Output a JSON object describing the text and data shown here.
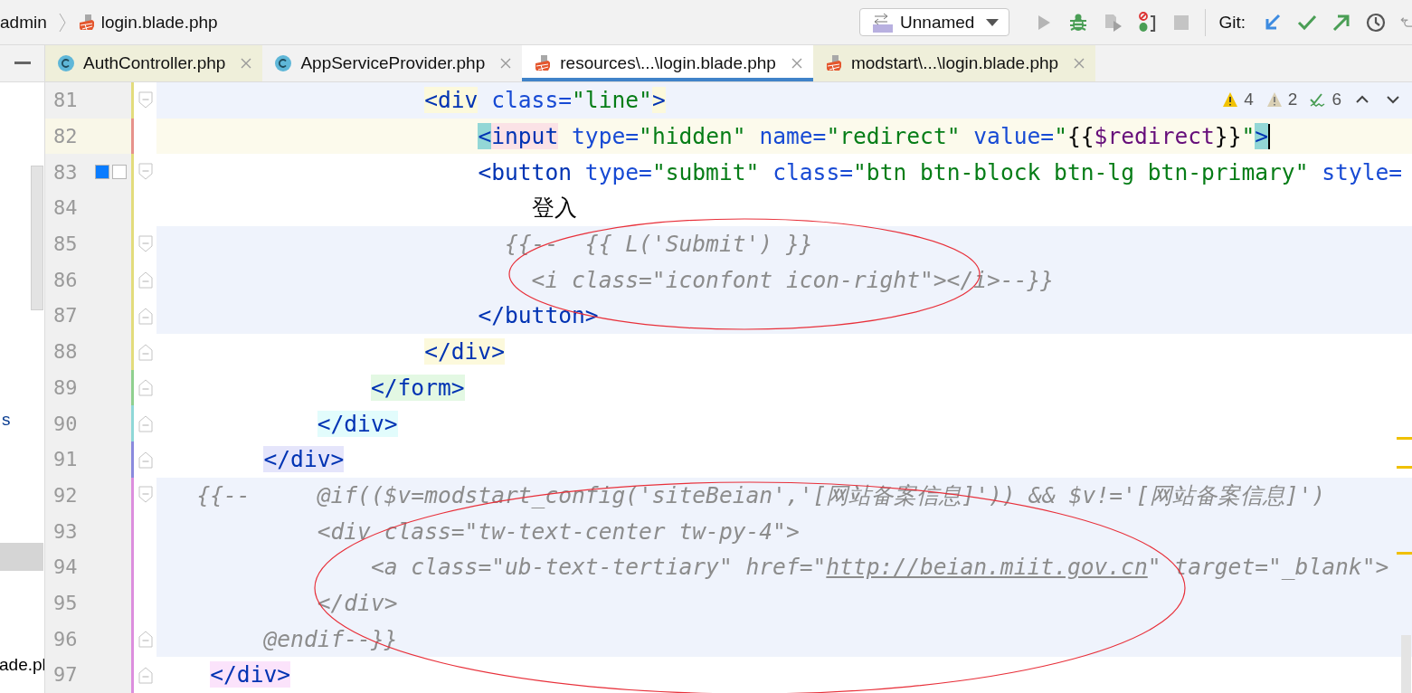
{
  "breadcrumb": {
    "items": [
      {
        "label": "admin",
        "kind": "folder"
      },
      {
        "label": "login.blade.php",
        "kind": "blade"
      }
    ]
  },
  "run_config": {
    "label": "Unnamed"
  },
  "git": {
    "label": "Git:"
  },
  "sidebar": {
    "fragments": [
      "s",
      "ade.pl"
    ]
  },
  "tabs": [
    {
      "label": "AuthController.php",
      "kind": "class",
      "selected": false,
      "color": "#efefda"
    },
    {
      "label": "AppServiceProvider.php",
      "kind": "class",
      "selected": false,
      "color": "#f2f2f2"
    },
    {
      "label": "resources\\...\\login.blade.php",
      "kind": "blade",
      "selected": true,
      "color": "#ffffff"
    },
    {
      "label": "modstart\\...\\login.blade.php",
      "kind": "blade",
      "selected": false,
      "color": "#efefda"
    }
  ],
  "inspections": {
    "warnings": "4",
    "weak_warnings": "2",
    "typos": "6"
  },
  "editor": {
    "lines": [
      {
        "number": "81",
        "color": "#e3dc7c",
        "kind": "fold_start",
        "shaded": true,
        "current": false,
        "tokens": [
          {
            "kind": "tag",
            "text": "                    <div",
            "color": "#fcf9dc"
          },
          {
            "kind": "attr",
            "text": " class="
          },
          {
            "kind": "string",
            "text": "\"line\""
          },
          {
            "kind": "tag",
            "text": ">",
            "color": "#fcf9dc"
          }
        ]
      },
      {
        "number": "82",
        "color": "#e7928b",
        "kind": "plain",
        "current": true,
        "shaded": false,
        "tokens": [
          {
            "kind": "tag",
            "text": "                        <",
            "color": "#93d7d6"
          },
          {
            "kind": "tag",
            "text": "input",
            "color": "#fbe2e6"
          },
          {
            "kind": "attr",
            "text": " type="
          },
          {
            "kind": "string",
            "text": "\"hidden\""
          },
          {
            "kind": "attr",
            "text": " name="
          },
          {
            "kind": "string",
            "text": "\"redirect\""
          },
          {
            "kind": "attr",
            "text": " value="
          },
          {
            "kind": "string",
            "text": "\""
          },
          {
            "kind": "text",
            "text": "{{"
          },
          {
            "kind": "variable",
            "text": "$redirect"
          },
          {
            "kind": "text",
            "text": "}}"
          },
          {
            "kind": "string",
            "text": "\""
          },
          {
            "kind": "tag",
            "text": ">",
            "color": "#93d7d6"
          }
        ]
      },
      {
        "number": "83",
        "color": "#e3dc7c",
        "kind": "fold_start",
        "current": false,
        "shaded": false,
        "swatches": [
          {
            "color": "#0a7cff"
          },
          {
            "color": "#ffffff"
          }
        ],
        "tokens": [
          {
            "kind": "tag",
            "text": "                        <button"
          },
          {
            "kind": "attr",
            "text": " type="
          },
          {
            "kind": "string",
            "text": "\"submit\""
          },
          {
            "kind": "attr",
            "text": " class="
          },
          {
            "kind": "string",
            "text": "\"btn btn-block btn-lg btn-primary\""
          },
          {
            "kind": "attr",
            "text": " style="
          }
        ]
      },
      {
        "number": "84",
        "color": "#e3dc7c",
        "kind": "plain",
        "current": false,
        "shaded": false,
        "tokens": [
          {
            "kind": "text",
            "text": "                            登入"
          }
        ]
      },
      {
        "number": "85",
        "color": "#e3dc7c",
        "kind": "fold_start",
        "current": false,
        "shaded": true,
        "tokens": [
          {
            "kind": "comment",
            "text": "                          {{--  {{ L('Submit') }}"
          }
        ]
      },
      {
        "number": "86",
        "color": "#e3dc7c",
        "kind": "fold_end",
        "current": false,
        "shaded": true,
        "tokens": [
          {
            "kind": "comment",
            "text": "                            <i class=\"iconfont icon-right\"></i>--}}"
          }
        ]
      },
      {
        "number": "87",
        "color": "#e3dc7c",
        "kind": "fold_end",
        "current": false,
        "shaded": true,
        "tokens": [
          {
            "kind": "tag",
            "text": "                        </button>"
          }
        ]
      },
      {
        "number": "88",
        "color": "#e3dc7c",
        "kind": "fold_end",
        "current": false,
        "shaded": false,
        "tokens": [
          {
            "kind": "tag",
            "text": "                    </div>",
            "color": "#fcf9dc"
          }
        ]
      },
      {
        "number": "89",
        "color": "#8fd08f",
        "kind": "fold_end",
        "current": false,
        "shaded": false,
        "tokens": [
          {
            "kind": "tag",
            "text": "                </form>",
            "color": "#e3f8e3"
          }
        ]
      },
      {
        "number": "90",
        "color": "#8fd8d8",
        "kind": "fold_end",
        "current": false,
        "shaded": false,
        "tokens": [
          {
            "kind": "tag",
            "text": "            </div>",
            "color": "#e2fcfc"
          }
        ]
      },
      {
        "number": "91",
        "color": "#8a8ade",
        "kind": "fold_end",
        "current": false,
        "shaded": false,
        "tokens": [
          {
            "kind": "tag",
            "text": "        </div>",
            "color": "#e5e5fb"
          }
        ]
      },
      {
        "number": "92",
        "color": "#dc8ede",
        "kind": "fold_start",
        "current": false,
        "shaded": true,
        "tokens": [
          {
            "kind": "comment",
            "text": "   {{--     @if(($v=modstart_config('siteBeian','[网站备案信息]')) && $v!='[网站备案信息]')"
          }
        ]
      },
      {
        "number": "93",
        "color": "#dc8ede",
        "kind": "plain",
        "current": false,
        "shaded": true,
        "tokens": [
          {
            "kind": "comment",
            "text": "            <div class=\"tw-text-center tw-py-4\">"
          }
        ]
      },
      {
        "number": "94",
        "color": "#dc8ede",
        "kind": "plain",
        "current": false,
        "shaded": true,
        "tokens": [
          {
            "kind": "comment",
            "text": "                <a class=\"ub-text-tertiary\" href=\""
          },
          {
            "kind": "link",
            "text": "http://beian.miit.gov.cn"
          },
          {
            "kind": "comment",
            "text": "\" target=\"_blank\">"
          }
        ]
      },
      {
        "number": "95",
        "color": "#dc8ede",
        "kind": "plain",
        "current": false,
        "shaded": true,
        "tokens": [
          {
            "kind": "comment",
            "text": "            </div>"
          }
        ]
      },
      {
        "number": "96",
        "color": "#dc8ede",
        "kind": "fold_end",
        "current": false,
        "shaded": true,
        "tokens": [
          {
            "kind": "comment",
            "text": "        @endif--}}"
          }
        ]
      },
      {
        "number": "97",
        "color": "#dc8ede",
        "kind": "fold_end",
        "current": false,
        "shaded": false,
        "tokens": [
          {
            "kind": "tag",
            "text": "    </div>",
            "color": "#fbe3fb"
          }
        ]
      }
    ]
  }
}
